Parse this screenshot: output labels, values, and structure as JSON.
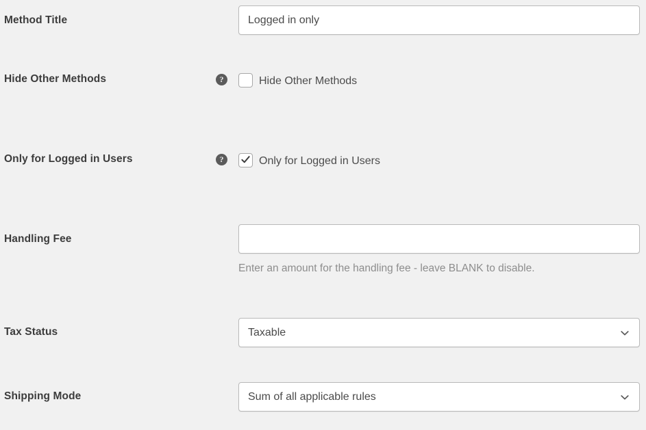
{
  "rows": [
    {
      "id": "method-title",
      "label": "Method Title",
      "type": "text",
      "value": "Logged in only",
      "placeholder": ""
    },
    {
      "id": "hide-other-methods",
      "label": "Hide Other Methods",
      "type": "checkbox",
      "checkbox_label": "Hide Other Methods",
      "checked": false,
      "help_icon": "question-mark-icon",
      "help_glyph": "?"
    },
    {
      "id": "only-for-logged-in-users",
      "label": "Only for Logged in Users",
      "type": "checkbox",
      "checkbox_label": "Only for Logged in Users",
      "checked": true,
      "help_icon": "question-mark-icon",
      "help_glyph": "?"
    },
    {
      "id": "handling-fee",
      "label": "Handling Fee",
      "type": "text",
      "value": "",
      "placeholder": "",
      "description": "Enter an amount for the handling fee - leave BLANK to disable."
    },
    {
      "id": "tax-status",
      "label": "Tax Status",
      "type": "select",
      "value": "Taxable",
      "chevron_icon": "chevron-down-icon"
    },
    {
      "id": "shipping-mode",
      "label": "Shipping Mode",
      "type": "select",
      "value": "Sum of all applicable rules",
      "chevron_icon": "chevron-down-icon"
    }
  ],
  "colors": {
    "page_background": "#f1f1f1",
    "label_text": "#3c3c3c",
    "field_text": "#4a4a4a",
    "description_text": "#8d8d8d",
    "field_border": "#b9b9b9",
    "field_background": "#ffffff",
    "help_icon_background": "#5b5b5b"
  }
}
